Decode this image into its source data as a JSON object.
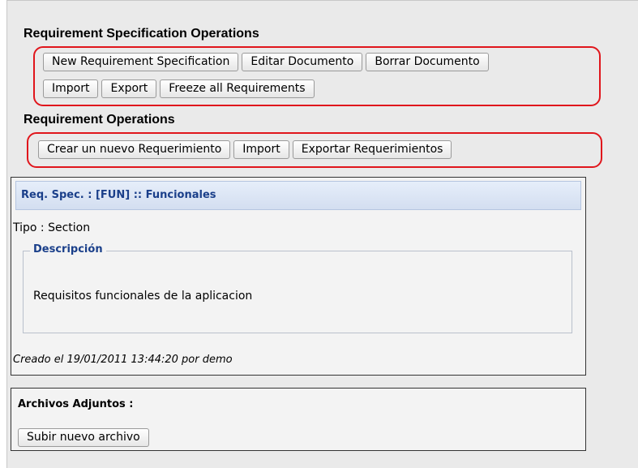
{
  "req_spec_ops": {
    "title": "Requirement Specification Operations",
    "buttons": [
      "New Requirement Specification",
      "Editar Documento",
      "Borrar Documento",
      "Import",
      "Export",
      "Freeze all Requirements"
    ]
  },
  "req_ops": {
    "title": "Requirement Operations",
    "buttons": [
      "Crear un nuevo Requerimiento",
      "Import",
      "Exportar Requerimientos"
    ]
  },
  "spec": {
    "header": "Req. Spec. : [FUN] :: Funcionales",
    "type_line": "Tipo : Section",
    "description_legend": "Descripción",
    "description_text": "Requisitos funcionales de la aplicacion",
    "created_line": "Creado el 19/01/2011 13:44:20  por demo"
  },
  "attachments": {
    "title": "Archivos Adjuntos :",
    "upload_button": "Subir nuevo archivo"
  },
  "colors": {
    "highlight_outline": "#e0161c",
    "header_text": "#1a3f8a"
  }
}
